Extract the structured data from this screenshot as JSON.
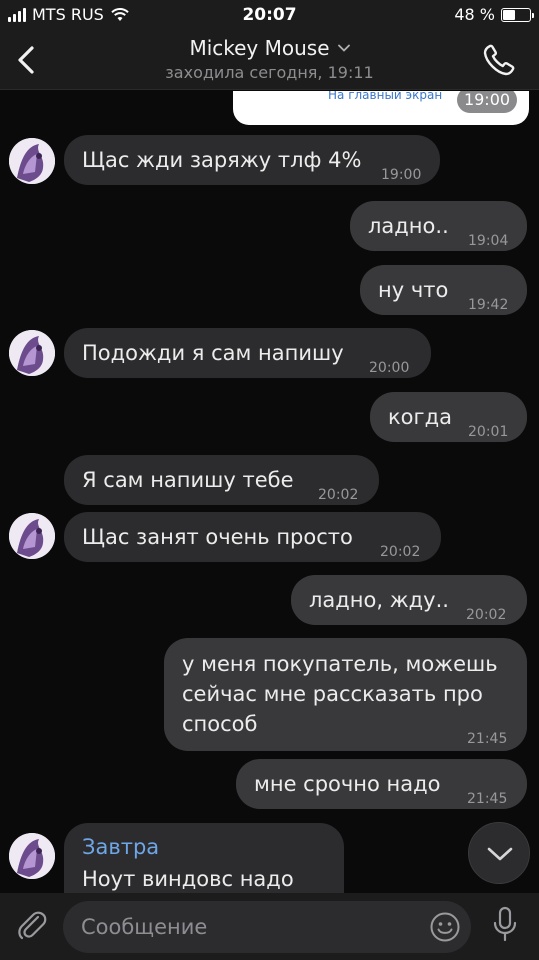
{
  "status": {
    "carrier": "MTS RUS",
    "time": "20:07",
    "battery_text": "48 %",
    "battery_level": 0.48
  },
  "header": {
    "title": "Mickey Mouse",
    "subtitle": "заходила сегодня, 19:11"
  },
  "prev_card": {
    "link": "На главный экран",
    "time": "19:00"
  },
  "messages": [
    {
      "text": "Щас жди заряжу тлф 4%",
      "time": "19:00",
      "dir": "in"
    },
    {
      "text": "ладно..",
      "time": "19:04",
      "dir": "out"
    },
    {
      "text": "ну что",
      "time": "19:42",
      "dir": "out"
    },
    {
      "text": "Подожди я сам напишу",
      "time": "20:00",
      "dir": "in"
    },
    {
      "text": "когда",
      "time": "20:01",
      "dir": "out"
    },
    {
      "text": "Я сам напишу тебе",
      "time": "20:02",
      "dir": "in"
    },
    {
      "text": "Щас занят очень просто",
      "time": "20:02",
      "dir": "in"
    },
    {
      "text": "ладно, жду..",
      "time": "20:02",
      "dir": "out"
    },
    {
      "lines": [
        "у меня покупатель, можешь",
        "сейчас мне рассказать про",
        "способ"
      ],
      "time": "21:45",
      "dir": "out"
    },
    {
      "text": "мне срочно надо",
      "time": "21:45",
      "dir": "out"
    },
    {
      "reply_name": "Завтра",
      "text": "Ноут виндовс надо",
      "dir": "in"
    }
  ],
  "composer": {
    "placeholder": "Сообщение"
  },
  "colors": {
    "background": "#0a0a0a",
    "incoming_bubble": "#2c2c2e",
    "outgoing_bubble": "#39393b",
    "reply_name": "#6ea6e8"
  }
}
